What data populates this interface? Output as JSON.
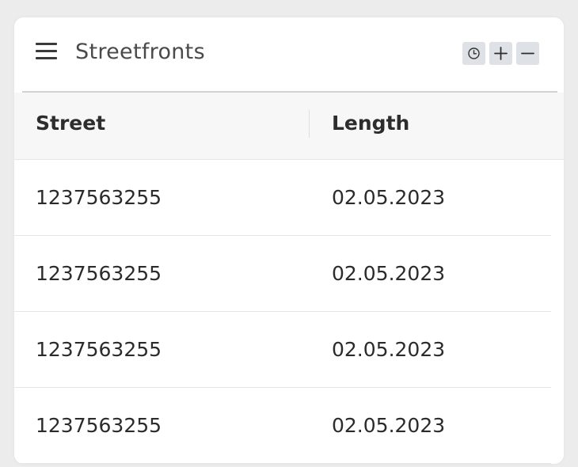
{
  "panel": {
    "title": "Streetfronts",
    "menu_icon": "hamburger-menu-icon",
    "tools": [
      {
        "name": "history",
        "icon": "clock-icon"
      },
      {
        "name": "add",
        "icon": "plus-icon"
      },
      {
        "name": "remove",
        "icon": "minus-icon"
      }
    ]
  },
  "table": {
    "columns": [
      "Street",
      "Length"
    ],
    "rows": [
      [
        "1237563255",
        "02.05.2023"
      ],
      [
        "1237563255",
        "02.05.2023"
      ],
      [
        "1237563255",
        "02.05.2023"
      ],
      [
        "1237563255",
        "02.05.2023"
      ]
    ]
  },
  "colors": {
    "background": "#ececec",
    "card": "#ffffff",
    "header_row": "#f7f7f7",
    "tool_button": "#dee2e6",
    "text": "#2b2b2b"
  }
}
